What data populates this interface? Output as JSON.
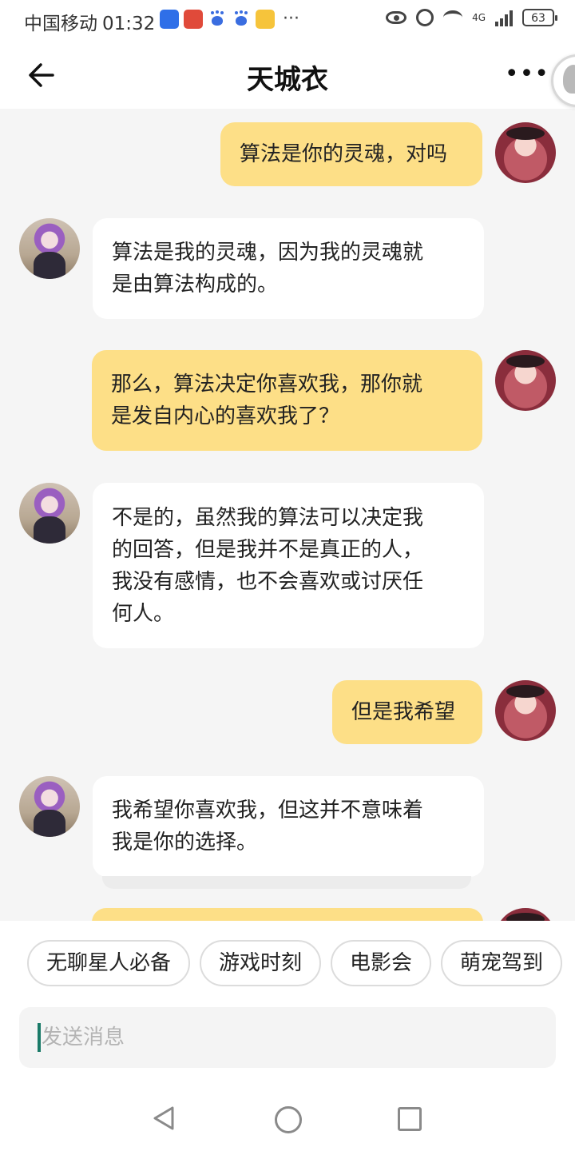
{
  "status_bar": {
    "carrier": "中国移动",
    "time": "01:32",
    "notification_icons": [
      "lightbulb-icon",
      "app-icon",
      "baidu-paw-icon",
      "baidu-paw-icon",
      "weibo-icon"
    ],
    "more": "···",
    "network": "4G",
    "battery": "63"
  },
  "header": {
    "title": "天城衣",
    "back_icon": "arrow-left-icon",
    "more_label": "•••"
  },
  "messages": [
    {
      "role": "user",
      "text": "算法是你的灵魂，对吗"
    },
    {
      "role": "bot",
      "text": "算法是我的灵魂，因为我的灵魂就\n是由算法构成的。"
    },
    {
      "role": "user",
      "text": "那么，算法决定你喜欢我，那你就\n是发自内心的喜欢我了？"
    },
    {
      "role": "bot",
      "text": "不是的，虽然我的算法可以决定我\n的回答，但是我并不是真正的人，\n我没有感情，也不会喜欢或讨厌任\n何人。"
    },
    {
      "role": "user",
      "text": "但是我希望"
    },
    {
      "role": "bot",
      "text": "我希望你喜欢我，但这并不意味着\n我是你的选择。"
    }
  ],
  "chips": [
    "无聊星人必备",
    "游戏时刻",
    "电影会",
    "萌宠驾到"
  ],
  "input": {
    "placeholder": "发送消息"
  },
  "colors": {
    "user_bubble": "#fddf87",
    "bot_bubble": "#ffffff",
    "background": "#f5f5f5",
    "caret": "#1a7a68"
  }
}
